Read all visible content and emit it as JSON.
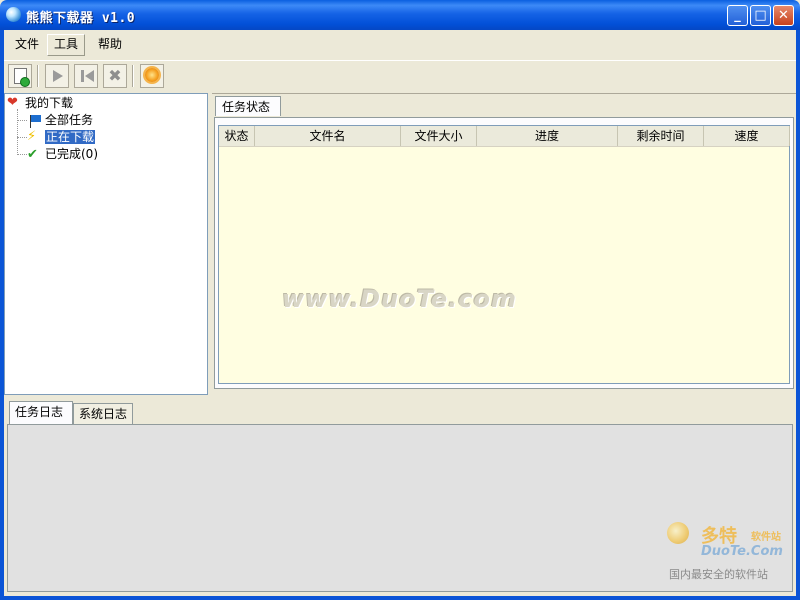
{
  "window": {
    "title": "熊熊下载器 v1.0",
    "controls": {
      "minimize": "_",
      "maximize": "□",
      "close": "✕"
    }
  },
  "menu": {
    "items": [
      "文件",
      "工具",
      "帮助"
    ],
    "active_index": 1
  },
  "toolbar": {
    "buttons": [
      {
        "icon": "new-task-icon",
        "enabled": true
      },
      {
        "icon": "play-icon",
        "enabled": false
      },
      {
        "icon": "stop-icon",
        "enabled": false
      },
      {
        "icon": "delete-icon",
        "enabled": false,
        "glyph": "✖"
      },
      {
        "icon": "settings-icon",
        "enabled": true
      }
    ]
  },
  "tree": {
    "root": {
      "label": "我的下载",
      "icon": "heart-icon"
    },
    "children": [
      {
        "label": "全部任务",
        "icon": "flag-icon",
        "selected": false
      },
      {
        "label": "正在下载",
        "icon": "lightning-icon",
        "selected": true
      },
      {
        "label": "已完成(0)",
        "icon": "check-icon",
        "selected": false
      }
    ]
  },
  "task_panel": {
    "tab_label": "任务状态",
    "columns": [
      "状态",
      "文件名",
      "文件大小",
      "进度",
      "剩余时间",
      "速度"
    ],
    "rows": []
  },
  "watermark": "www.DuoTe.com",
  "log_panel": {
    "tabs": [
      "任务日志",
      "系统日志"
    ],
    "active_index": 0
  },
  "brand": {
    "name": "多特",
    "sub": "软件站",
    "domain": "DuoTe.Com",
    "tagline": "国内最安全的软件站"
  },
  "colors": {
    "titlebar": "#0250d8",
    "grid_background": "#fffee1",
    "selection": "#316ac5",
    "log_background": "#e1e1e1"
  }
}
